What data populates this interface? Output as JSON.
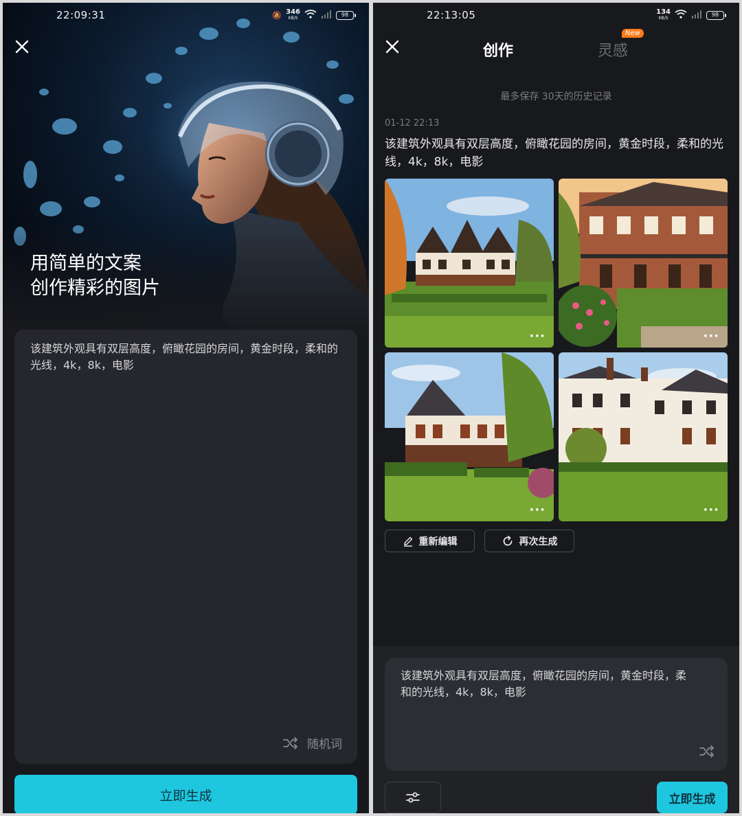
{
  "left_screen": {
    "status_time": "22:09:31",
    "net_speed": "346",
    "net_unit": "KB/S",
    "battery": "98",
    "slogan_line1": "用简单的文案",
    "slogan_line2": "创作精彩的图片",
    "prompt_text": "该建筑外观具有双层高度，俯瞰花园的房间，黄金时段，柔和的光线，4k，8k，电影",
    "random_label": "随机词",
    "generate_label": "立即生成"
  },
  "right_screen": {
    "status_time": "22:13:05",
    "net_speed": "134",
    "net_unit": "KB/S",
    "battery": "98",
    "tabs": [
      {
        "label": "创作",
        "active": true
      },
      {
        "label": "灵感",
        "active": false
      }
    ],
    "new_badge": "New",
    "history_note": "最多保存 30天的历史记录",
    "timestamp": "01-12 22:13",
    "result_prompt": "该建筑外观具有双层高度，俯瞰花园的房间，黄金时段，柔和的光线，4k，8k，电影",
    "images": [
      "manor-garden-1",
      "manor-garden-2",
      "manor-garden-3",
      "manor-garden-4"
    ],
    "more_label": "···",
    "edit_label": "重新编辑",
    "regenerate_label": "再次生成",
    "input_text": "该建筑外观具有双层高度，俯瞰花园的房间，黄金时段，柔和的光线，4k，8k，电影",
    "generate_label": "立即生成"
  },
  "colors": {
    "accent": "#1fc6df",
    "background": "#18191d",
    "card": "#26272c"
  }
}
